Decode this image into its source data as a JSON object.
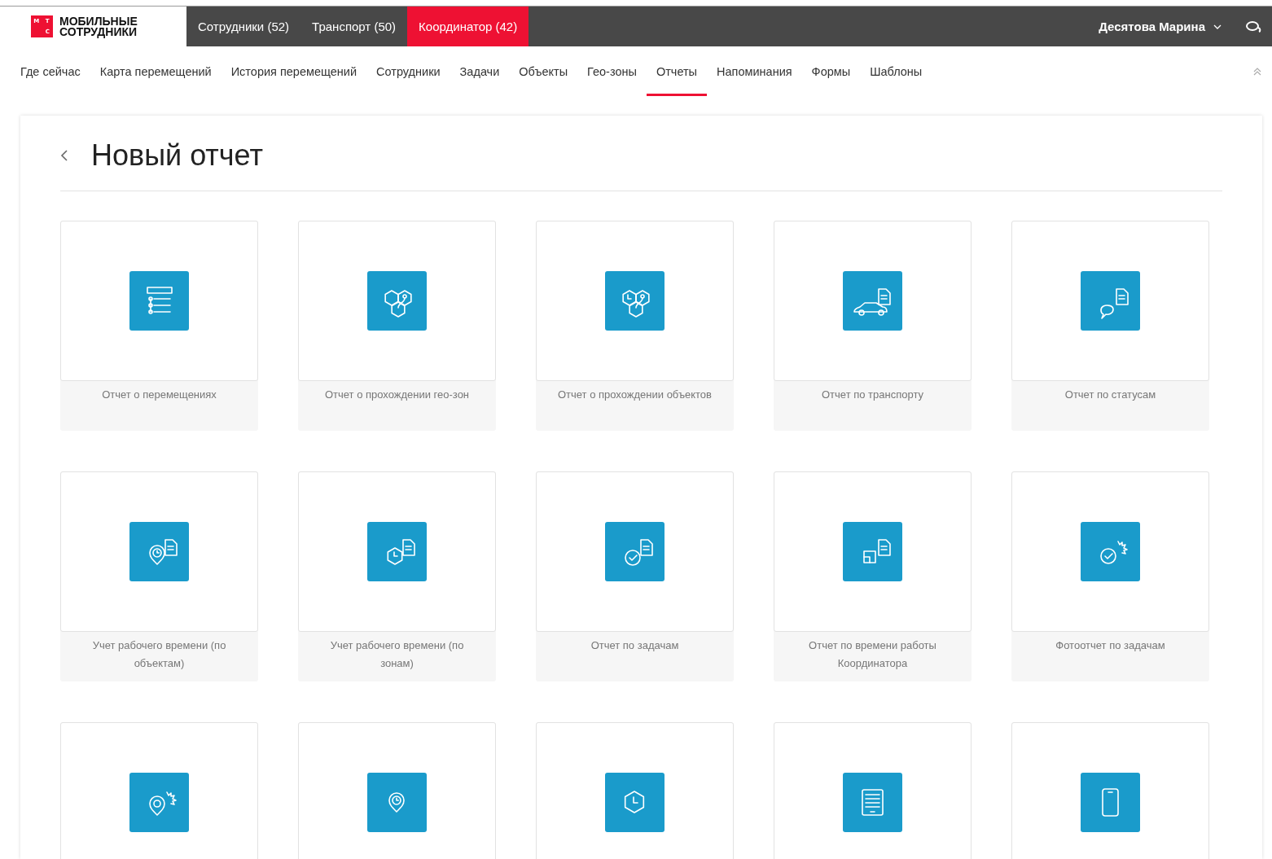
{
  "logo": {
    "mark": [
      "М",
      "Т",
      "С"
    ],
    "title": "МОБИЛЬНЫЕ СОТРУДНИКИ"
  },
  "top_tabs": [
    {
      "label": "Сотрудники (52)",
      "selected": false
    },
    {
      "label": "Транспорт (50)",
      "selected": false
    },
    {
      "label": "Координатор (42)",
      "selected": true
    }
  ],
  "user": {
    "name": "Десятова Марина"
  },
  "nav": [
    {
      "label": "Где сейчас",
      "selected": false
    },
    {
      "label": "Карта перемещений",
      "selected": false
    },
    {
      "label": "История перемещений",
      "selected": false
    },
    {
      "label": "Сотрудники",
      "selected": false
    },
    {
      "label": "Задачи",
      "selected": false
    },
    {
      "label": "Объекты",
      "selected": false
    },
    {
      "label": "Гео-зоны",
      "selected": false
    },
    {
      "label": "Отчеты",
      "selected": true
    },
    {
      "label": "Напоминания",
      "selected": false
    },
    {
      "label": "Формы",
      "selected": false
    },
    {
      "label": "Шаблоны",
      "selected": false
    }
  ],
  "page": {
    "title": "Новый отчет"
  },
  "reports": [
    {
      "kind": "route",
      "label": "Отчет о перемещениях"
    },
    {
      "kind": "geozone",
      "label": "Отчет о прохождении гео-зон"
    },
    {
      "kind": "object",
      "label": "Отчет о прохождении объектов"
    },
    {
      "kind": "car",
      "label": "Отчет по транспорту"
    },
    {
      "kind": "chat",
      "label": "Отчет по статусам"
    },
    {
      "kind": "pinclockdoc",
      "label": "Учет рабочего времени (по объектам)"
    },
    {
      "kind": "hexclockdoc",
      "label": "Учет рабочего времени (по зонам)"
    },
    {
      "kind": "checkdoc",
      "label": "Отчет по задачам"
    },
    {
      "kind": "copydoc",
      "label": "Отчет по времени работы Координатора"
    },
    {
      "kind": "checkburst",
      "label": "Фотоотчет по задачам"
    },
    {
      "kind": "pinburst"
    },
    {
      "kind": "pinclock"
    },
    {
      "kind": "hexclock"
    },
    {
      "kind": "tablet"
    },
    {
      "kind": "phone"
    }
  ]
}
